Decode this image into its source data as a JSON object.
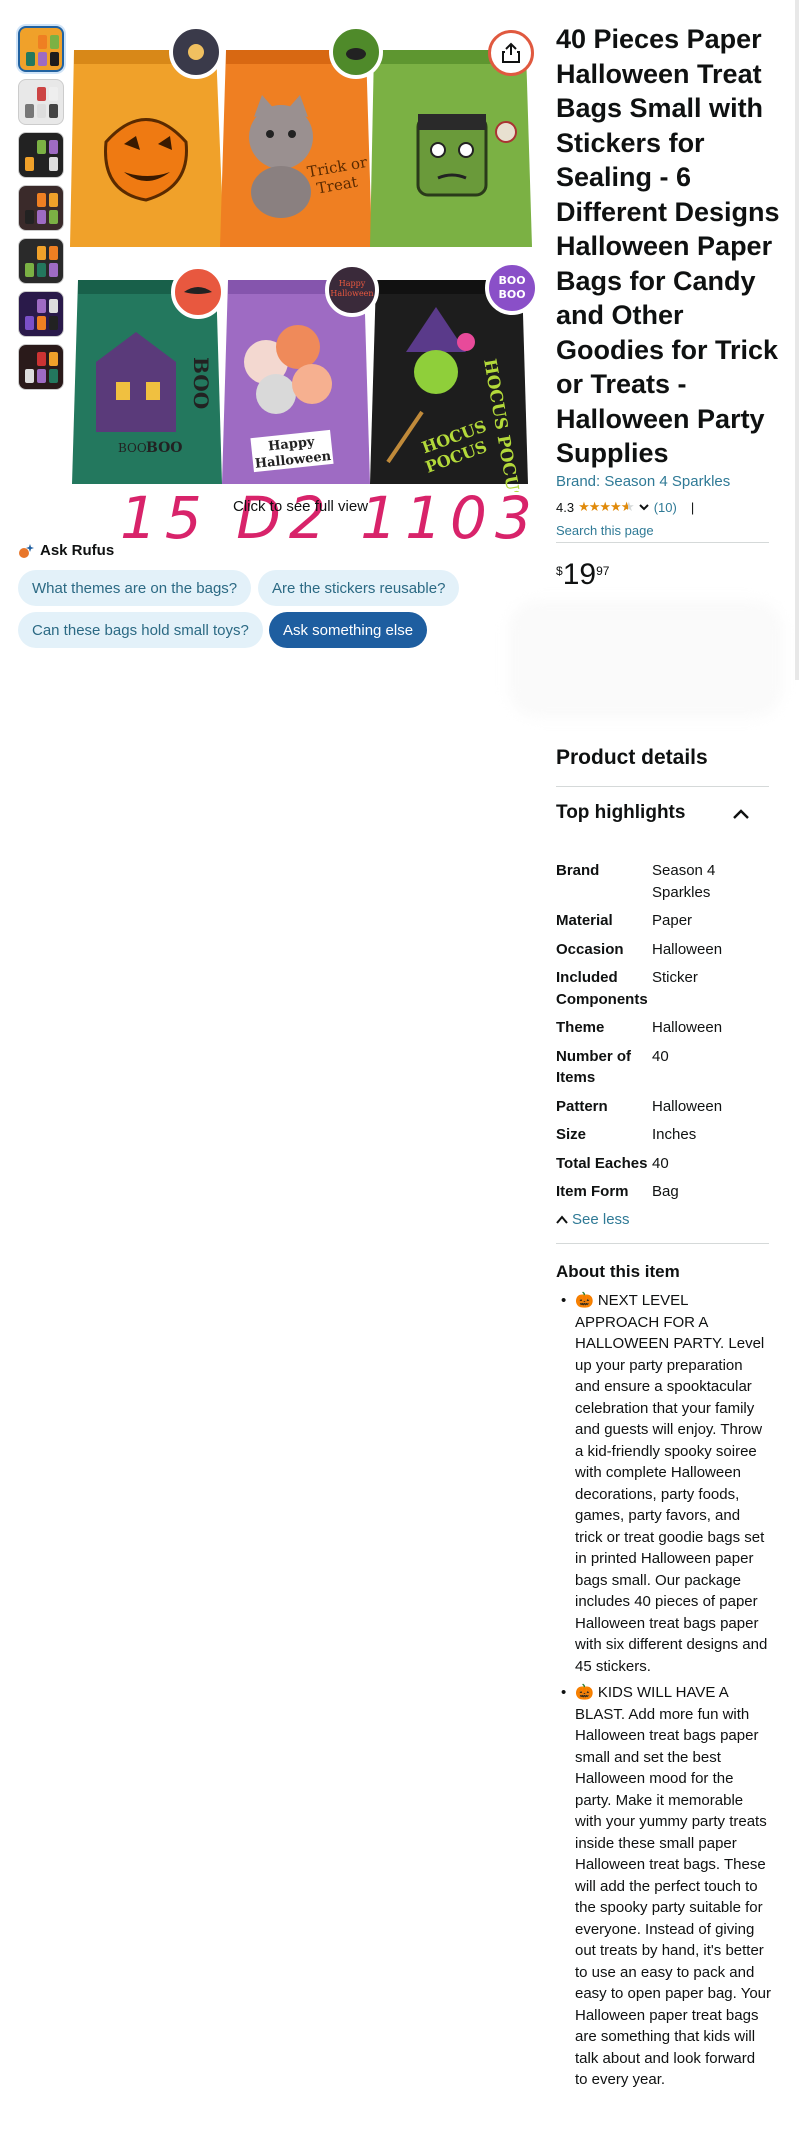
{
  "gallery": {
    "thumbnail_count": 7,
    "full_view_hint": "Click to see full view",
    "handwritten_overlay": "15 D2 1103"
  },
  "main_image": {
    "bags": [
      {
        "color": "#f0a12a",
        "sticker_color": "#3a3a4a",
        "label": ""
      },
      {
        "color": "#ef7f22",
        "sticker_color": "#4f8a2a",
        "label": "Trick or Treat"
      },
      {
        "color": "#7bb144",
        "sticker_color": "#e8583f",
        "label": ""
      },
      {
        "color": "#23785e",
        "sticker_color": "#e8583f",
        "label": "BOO"
      },
      {
        "color": "#9e6bc3",
        "sticker_color": "#3a2a3a",
        "label": "Happy Halloween"
      },
      {
        "color": "#1d1d1d",
        "sticker_color": "#8a4fc8",
        "label": "HOCUS POCUS"
      }
    ],
    "sticker_texts": [
      "Happy Halloween",
      "BOO BOO"
    ]
  },
  "rufus": {
    "title": "Ask Rufus",
    "chips": [
      "What themes are on the bags?",
      "Are the stickers reusable?",
      "Can these bags hold small toys?",
      "Ask something else"
    ]
  },
  "product": {
    "title": "40 Pieces Paper Halloween Treat Bags Small with Stickers for Sealing - 6 Different Designs Halloween Paper Bags for Candy and Other Goodies for Trick or Treats - Halloween Party Supplies",
    "brand_link": "Brand: Season 4 Sparkles",
    "rating": "4.3",
    "stars_value": 4.3,
    "review_count": "(10)",
    "rating_divider": "|",
    "search_link": "Search this page",
    "price": {
      "symbol": "$",
      "whole": "19",
      "fraction": "97"
    }
  },
  "details": {
    "heading": "Product details",
    "highlights_heading": "Top highlights",
    "specs": [
      {
        "key": "Brand",
        "value": "Season 4 Sparkles"
      },
      {
        "key": "Material",
        "value": "Paper"
      },
      {
        "key": "Occasion",
        "value": "Halloween"
      },
      {
        "key": "Included Components",
        "value": "Sticker"
      },
      {
        "key": "Theme",
        "value": "Halloween"
      },
      {
        "key": "Number of Items",
        "value": "40"
      },
      {
        "key": "Pattern",
        "value": "Halloween"
      },
      {
        "key": "Size",
        "value": "Inches"
      },
      {
        "key": "Total Eaches",
        "value": "40"
      },
      {
        "key": "Item Form",
        "value": "Bag"
      }
    ],
    "see_less": "See less"
  },
  "about": {
    "heading": "About this item",
    "bullets": [
      "🎃 NEXT LEVEL APPROACH FOR A HALLOWEEN PARTY. Level up your party preparation and ensure a spooktacular celebration that your family and guests will enjoy. Throw a kid-friendly spooky soiree with complete Halloween decorations, party foods, games, party favors, and trick or treat goodie bags set in printed Halloween paper bags small. Our package includes 40 pieces of paper Halloween treat bags paper with six different designs and 45 stickers.",
      "🎃 KIDS WILL HAVE A BLAST. Add more fun with Halloween treat bags paper small and set the best Halloween mood for the party. Make it memorable with your yummy party treats inside these small paper Halloween treat bags. These will add the perfect touch to the spooky party suitable for everyone. Instead of giving out treats by hand, it's better to use an easy to pack and easy to open paper bag. Your Halloween paper treat bags are something that kids will talk about and look forward to every year."
    ]
  }
}
